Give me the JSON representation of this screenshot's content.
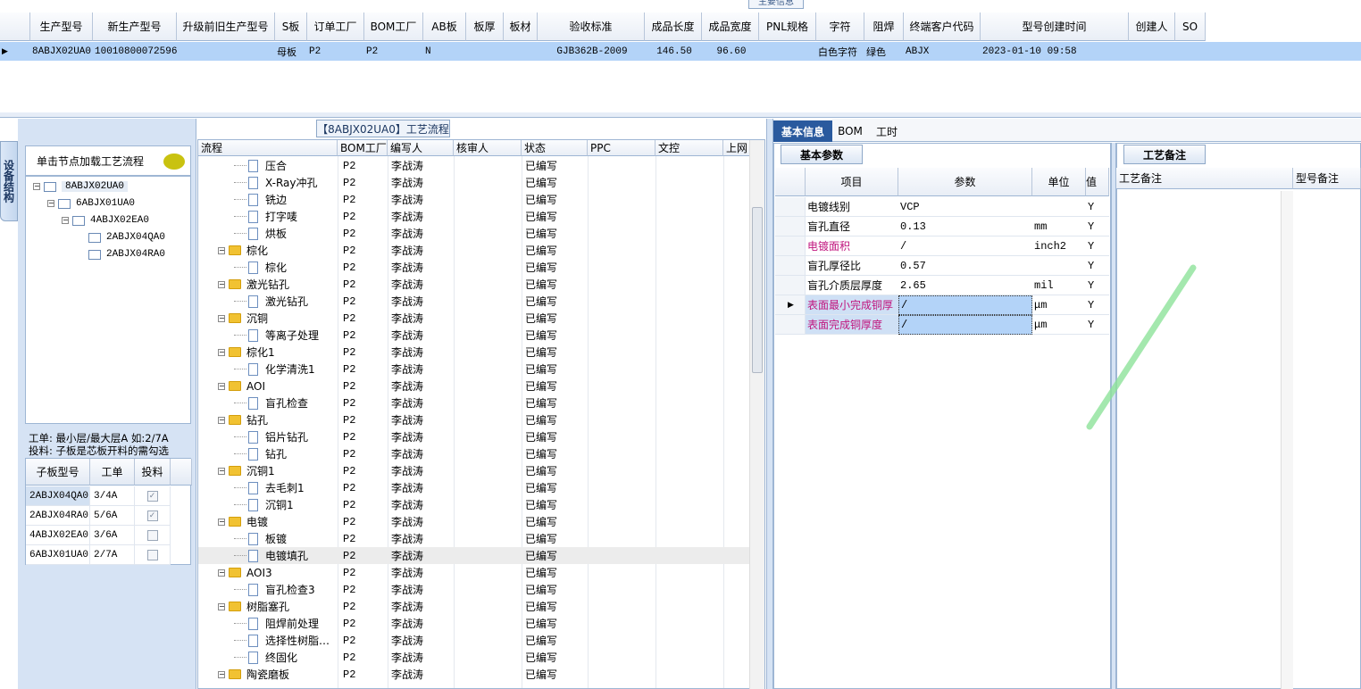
{
  "main_grid": {
    "section_title": "主要信息",
    "columns": [
      "生产型号",
      "新生产型号",
      "升级前旧生产型号",
      "S板",
      "订单工厂",
      "BOM工厂",
      "AB板",
      "板厚",
      "板材",
      "验收标准",
      "成品长度",
      "成品宽度",
      "PNL规格",
      "字符",
      "阻焊",
      "终端客户代码",
      "型号创建时间",
      "创建人",
      "SO"
    ],
    "row": [
      "8ABJX02UA0",
      "10010800072596",
      "",
      "母板",
      "P2",
      "P2",
      "N",
      "",
      "",
      "GJB362B-2009",
      "146.50",
      "96.60",
      "",
      "白色字符",
      "绿色",
      "ABJX",
      "2023-01-10 09:58",
      "",
      ""
    ]
  },
  "left_panel": {
    "vertical_tab": "设备结构",
    "hint": "单击节点加载工艺流程",
    "tree": [
      "8ABJX02UA0",
      "6ABJX01UA0",
      "4ABJX02EA0",
      "2ABJX04QA0",
      "2ABJX04RA0"
    ],
    "note_line1": "工单: 最小层/最大层A 如:2/7A",
    "note_line2": "投料: 子板是芯板开料的需勾选",
    "sub_grid": {
      "columns": [
        "子板型号",
        "工单",
        "投料"
      ],
      "rows": [
        {
          "model": "2ABJX04QA0",
          "order": "3/4A",
          "checked": true
        },
        {
          "model": "2ABJX04RA0",
          "order": "5/6A",
          "checked": true
        },
        {
          "model": "4ABJX02EA0",
          "order": "3/6A",
          "checked": false
        },
        {
          "model": "6ABJX01UA0",
          "order": "2/7A",
          "checked": false
        }
      ]
    }
  },
  "flow": {
    "title": "【8ABJX02UA0】工艺流程",
    "columns": [
      "流程",
      "BOM工厂",
      "编写人",
      "核审人",
      "状态",
      "PPC",
      "文控",
      "上网"
    ],
    "rows": [
      {
        "name": "压合",
        "type": "doc",
        "bom": "P2",
        "writer": "李战涛",
        "status": "已编写"
      },
      {
        "name": "X-Ray冲孔",
        "type": "doc",
        "bom": "P2",
        "writer": "李战涛",
        "status": "已编写"
      },
      {
        "name": "铣边",
        "type": "doc",
        "bom": "P2",
        "writer": "李战涛",
        "status": "已编写"
      },
      {
        "name": "打字唛",
        "type": "doc",
        "bom": "P2",
        "writer": "李战涛",
        "status": "已编写"
      },
      {
        "name": "烘板",
        "type": "doc",
        "bom": "P2",
        "writer": "李战涛",
        "status": "已编写"
      },
      {
        "name": "棕化",
        "type": "folder",
        "bom": "P2",
        "writer": "李战涛",
        "status": "已编写"
      },
      {
        "name": "棕化",
        "type": "doc",
        "bom": "P2",
        "writer": "李战涛",
        "status": "已编写"
      },
      {
        "name": "激光钻孔",
        "type": "folder",
        "bom": "P2",
        "writer": "李战涛",
        "status": "已编写"
      },
      {
        "name": "激光钻孔",
        "type": "doc",
        "bom": "P2",
        "writer": "李战涛",
        "status": "已编写"
      },
      {
        "name": "沉铜",
        "type": "folder",
        "bom": "P2",
        "writer": "李战涛",
        "status": "已编写"
      },
      {
        "name": "等离子处理",
        "type": "doc",
        "bom": "P2",
        "writer": "李战涛",
        "status": "已编写"
      },
      {
        "name": "棕化1",
        "type": "folder",
        "bom": "P2",
        "writer": "李战涛",
        "status": "已编写"
      },
      {
        "name": "化学清洗1",
        "type": "doc",
        "bom": "P2",
        "writer": "李战涛",
        "status": "已编写"
      },
      {
        "name": "AOI",
        "type": "folder",
        "bom": "P2",
        "writer": "李战涛",
        "status": "已编写"
      },
      {
        "name": "盲孔检查",
        "type": "doc",
        "bom": "P2",
        "writer": "李战涛",
        "status": "已编写"
      },
      {
        "name": "钻孔",
        "type": "folder",
        "bom": "P2",
        "writer": "李战涛",
        "status": "已编写"
      },
      {
        "name": "铝片钻孔",
        "type": "doc",
        "bom": "P2",
        "writer": "李战涛",
        "status": "已编写"
      },
      {
        "name": "钻孔",
        "type": "doc",
        "bom": "P2",
        "writer": "李战涛",
        "status": "已编写"
      },
      {
        "name": "沉铜1",
        "type": "folder",
        "bom": "P2",
        "writer": "李战涛",
        "status": "已编写"
      },
      {
        "name": "去毛刺1",
        "type": "doc",
        "bom": "P2",
        "writer": "李战涛",
        "status": "已编写"
      },
      {
        "name": "沉铜1",
        "type": "doc",
        "bom": "P2",
        "writer": "李战涛",
        "status": "已编写"
      },
      {
        "name": "电镀",
        "type": "folder",
        "bom": "P2",
        "writer": "李战涛",
        "status": "已编写"
      },
      {
        "name": "板镀",
        "type": "doc",
        "bom": "P2",
        "writer": "李战涛",
        "status": "已编写"
      },
      {
        "name": "电镀填孔",
        "type": "doc",
        "bom": "P2",
        "writer": "李战涛",
        "status": "已编写",
        "selected": true
      },
      {
        "name": "AOI3",
        "type": "folder",
        "bom": "P2",
        "writer": "李战涛",
        "status": "已编写"
      },
      {
        "name": "盲孔检查3",
        "type": "doc",
        "bom": "P2",
        "writer": "李战涛",
        "status": "已编写"
      },
      {
        "name": "树脂塞孔",
        "type": "folder",
        "bom": "P2",
        "writer": "李战涛",
        "status": "已编写"
      },
      {
        "name": "阻焊前处理",
        "type": "doc",
        "bom": "P2",
        "writer": "李战涛",
        "status": "已编写"
      },
      {
        "name": "选择性树脂…",
        "type": "doc",
        "bom": "P2",
        "writer": "李战涛",
        "status": "已编写"
      },
      {
        "name": "终固化",
        "type": "doc",
        "bom": "P2",
        "writer": "李战涛",
        "status": "已编写"
      },
      {
        "name": "陶瓷磨板",
        "type": "folder",
        "bom": "P2",
        "writer": "李战涛",
        "status": "已编写"
      }
    ]
  },
  "right": {
    "tabs": [
      "基本信息",
      "BOM",
      "工时"
    ],
    "params_tab": "基本参数",
    "params_columns": [
      "项目",
      "参数",
      "单位",
      "值"
    ],
    "params": [
      {
        "item": "电镀线别",
        "value": "VCP",
        "unit": "",
        "flag": "Y",
        "pink": false
      },
      {
        "item": "盲孔直径",
        "value": "0.13",
        "unit": "mm",
        "flag": "Y",
        "pink": false
      },
      {
        "item": "电镀面积",
        "value": "/",
        "unit": "inch2",
        "flag": "Y",
        "pink": true
      },
      {
        "item": "盲孔厚径比",
        "value": "0.57",
        "unit": "",
        "flag": "Y",
        "pink": false
      },
      {
        "item": "盲孔介质层厚度",
        "value": "2.65",
        "unit": "mil",
        "flag": "Y",
        "pink": false
      },
      {
        "item": "表面最小完成铜厚",
        "value": "/",
        "unit": "μm",
        "flag": "Y",
        "pink": true
      },
      {
        "item": "表面完成铜厚度",
        "value": "/",
        "unit": "μm",
        "flag": "Y",
        "pink": true
      }
    ],
    "notes_tab": "工艺备注",
    "notes_columns": [
      "工艺备注",
      "型号备注"
    ]
  }
}
